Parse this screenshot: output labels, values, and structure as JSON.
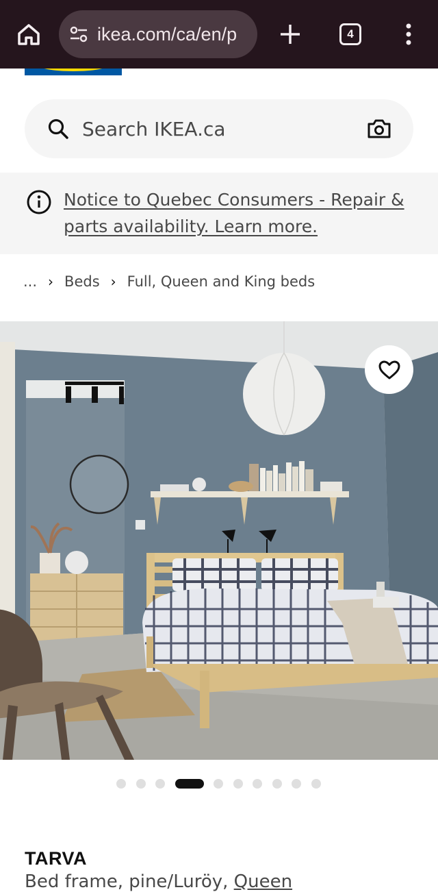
{
  "browser": {
    "url": "ikea.com/ca/en/p",
    "tab_count": "4"
  },
  "search": {
    "placeholder": "Search IKEA.ca"
  },
  "notice": {
    "text": "Notice to Quebec Consumers - Repair & parts availability. Learn more."
  },
  "breadcrumb": {
    "ellipsis": "...",
    "items": [
      "Beds",
      "Full, Queen and King beds"
    ]
  },
  "gallery": {
    "image_count": 10,
    "active_index": 3
  },
  "product": {
    "name": "TARVA",
    "description": "Bed frame, pine/Luröy, ",
    "size_link": "Queen"
  },
  "colors": {
    "chrome_bg": "#25151d",
    "omnibox_bg": "#4a3941",
    "panel_bg": "#f5f5f5",
    "brand_blue": "#0058a3",
    "brand_yellow": "#ffdb00"
  }
}
